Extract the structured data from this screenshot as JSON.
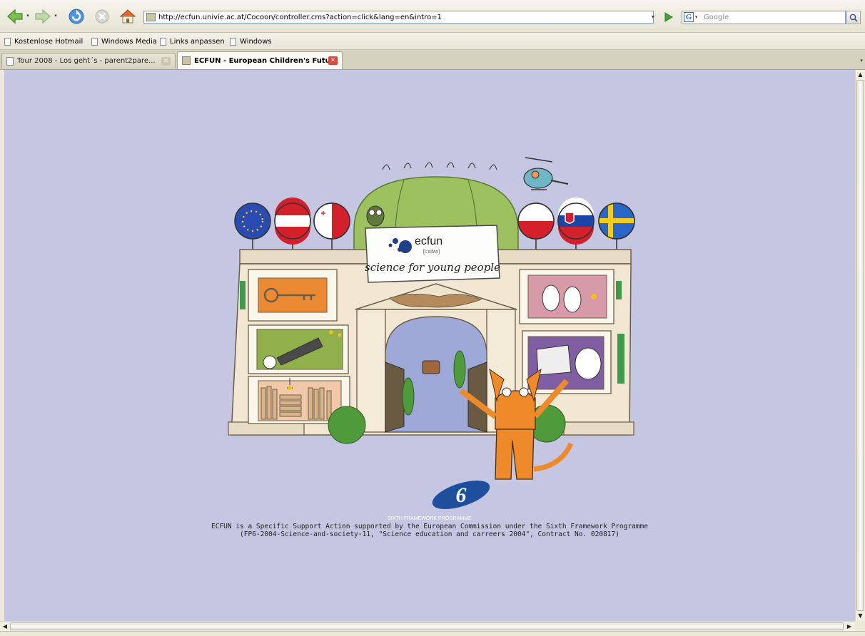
{
  "browser": {
    "address_url": "http://ecfun.univie.ac.at/Cocoon/controller.cms?action=click&lang=en&intro=1",
    "search_engine": "Google",
    "search_placeholder": "Google"
  },
  "bookmarks": [
    {
      "label": "Kostenlose Hotmail"
    },
    {
      "label": "Windows Media"
    },
    {
      "label": "Links anpassen"
    },
    {
      "label": "Windows"
    }
  ],
  "tabs": [
    {
      "label": "Tour 2008 - Los geht´s - parent2pare...",
      "active": false
    },
    {
      "label": "ECFUN - European Children's Futu...",
      "active": true
    }
  ],
  "page": {
    "sign_brand": "ecfun",
    "sign_phonetic": "[i:'sifʌn]",
    "sign_tagline": "science for young people",
    "fp6_label": "SIXTH FRAMEWORK PROGRAMME",
    "fp6_numeral": "6",
    "footnote_line1": "ECFUN is a Specific Support Action supported by the European Commission under the Sixth Framework Programme",
    "footnote_line2": "(FP6-2004-Science-and-society-11, \"Science education and carreers 2004\", Contract No. 020817)"
  },
  "colors": {
    "page_background": "#c4c6e2",
    "dome_green": "#9cc15e",
    "building_cream": "#f1e7d2",
    "cat_orange": "#ef8a2a",
    "fp6_blue": "#1d4f9c"
  }
}
